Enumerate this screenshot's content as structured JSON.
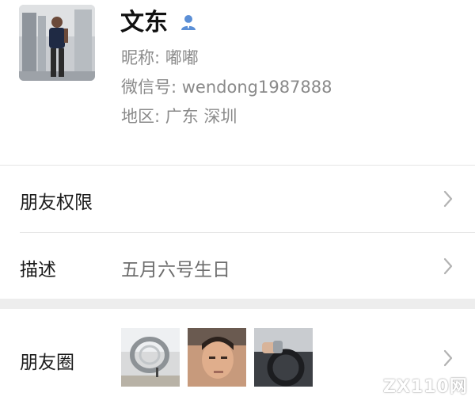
{
  "profile": {
    "name": "文东",
    "nickname_line": "昵称: 嘟嘟",
    "wechat_id_line": "微信号: wendong1987888",
    "region_line": "地区: 广东  深圳",
    "gender_icon": "person-icon",
    "gender_icon_color": "#5b8fd6"
  },
  "rows": {
    "permissions": {
      "label": "朋友权限"
    },
    "description": {
      "label": "描述",
      "value": "五月六号生日"
    },
    "moments": {
      "label": "朋友圈",
      "photo_count": 3
    }
  },
  "watermark": {
    "text": "ZX110网"
  },
  "colors": {
    "background": "#ffffff",
    "section_gap": "#ededed",
    "secondary_text": "#8a8a8a",
    "chevron": "#b2b2b2"
  }
}
